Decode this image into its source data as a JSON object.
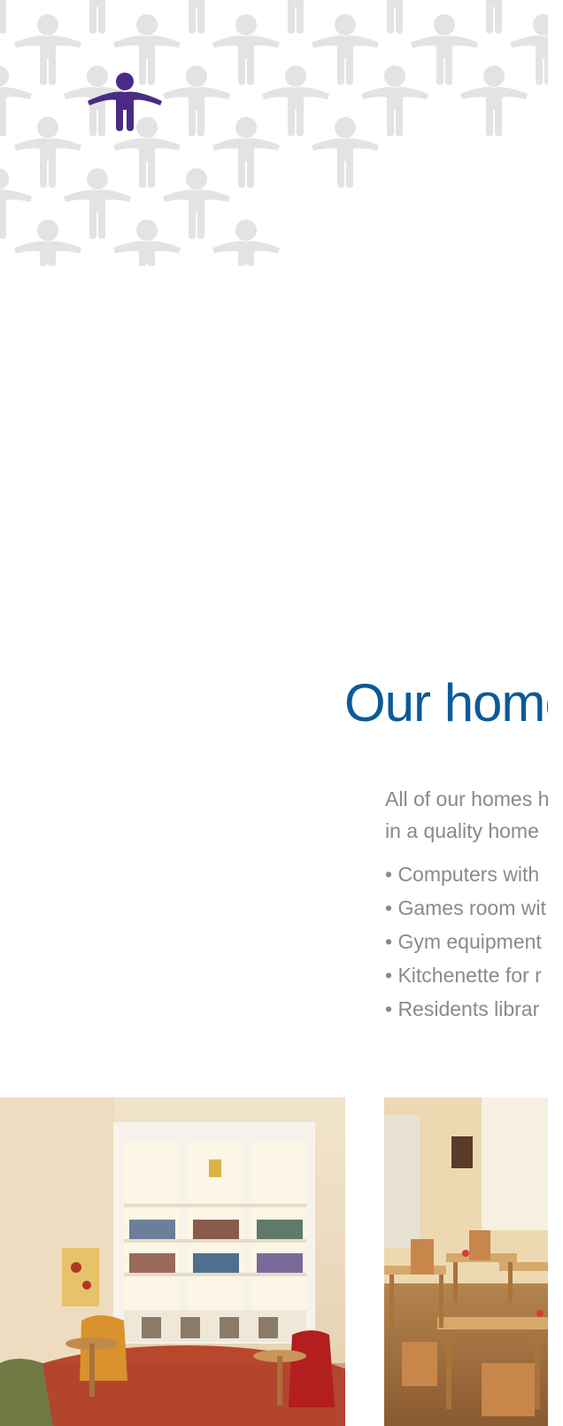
{
  "brand": {
    "accent_color": "#4b2a86",
    "heading_color": "#0a5a98",
    "text_color": "#8a8a8a",
    "pattern_color": "#e3e3e3",
    "logo_icon": "person-figure-icon"
  },
  "facilities": {
    "heading": "Our home",
    "intro_lines": [
      "All of our homes h",
      "in a quality home"
    ],
    "features": [
      "• Computers with",
      "• Games room wit",
      "• Gym equipment",
      "• Kitchenette for r",
      "• Residents librar"
    ]
  },
  "gallery": {
    "images": [
      {
        "subject": "lounge-with-bookcase-and-armchairs"
      },
      {
        "subject": "dining-room-with-tables-and-chairs"
      }
    ]
  }
}
